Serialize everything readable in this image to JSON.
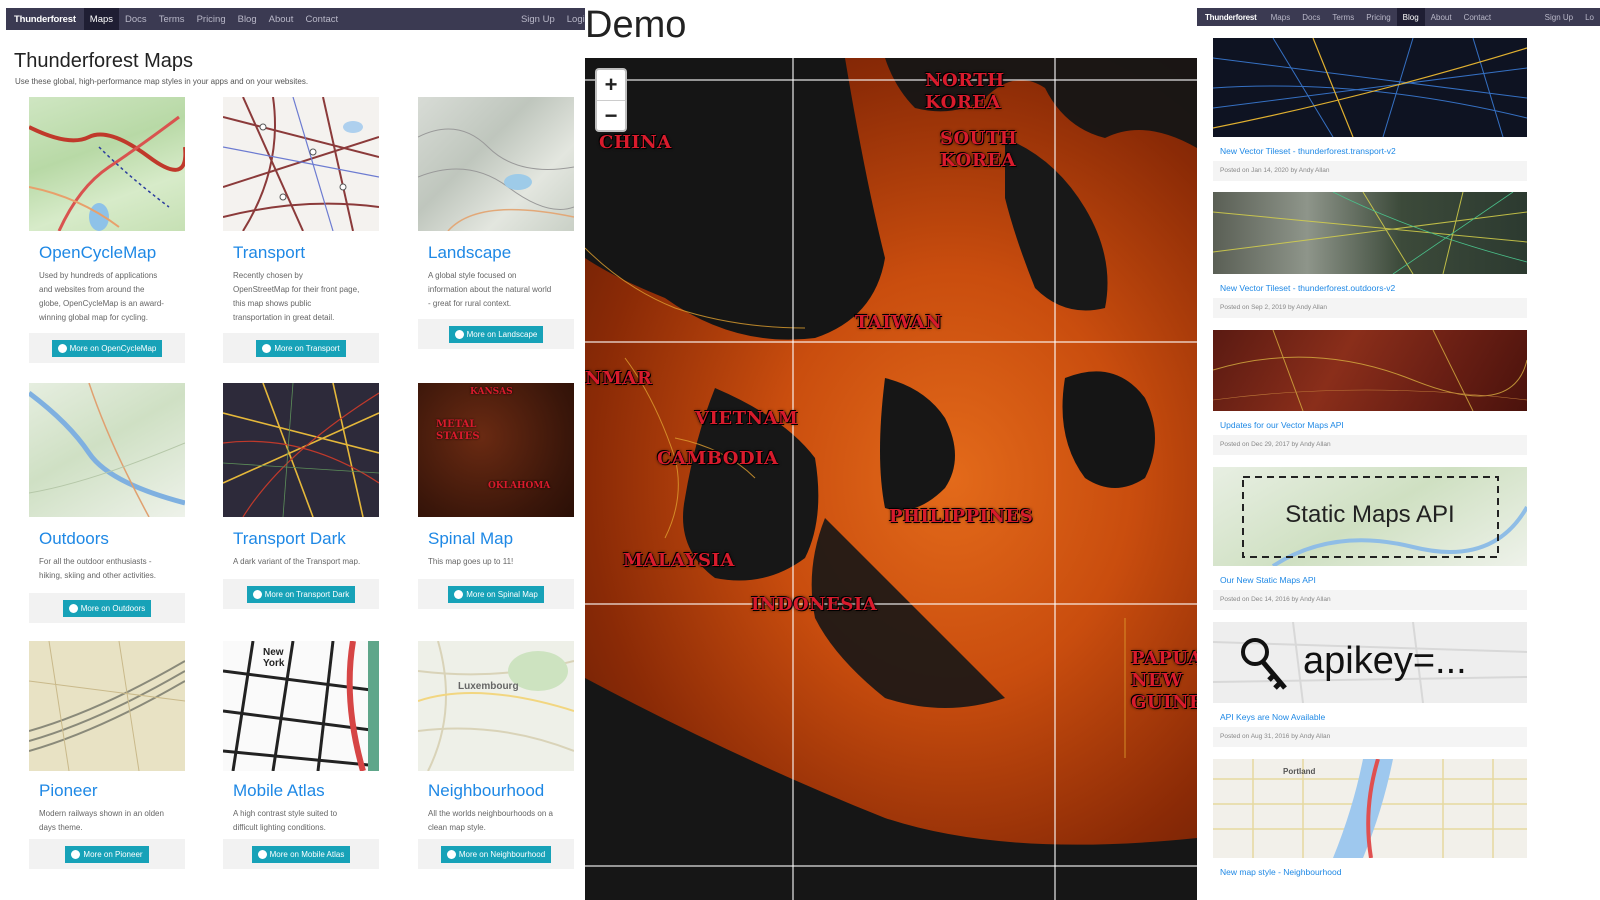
{
  "left": {
    "nav": {
      "brand": "Thunderforest",
      "items": [
        "Maps",
        "Docs",
        "Terms",
        "Pricing",
        "Blog",
        "About",
        "Contact"
      ],
      "active": "Maps",
      "right_items": [
        "Sign Up",
        "Login"
      ]
    },
    "title": "Thunderforest Maps",
    "subtitle": "Use these global, high-performance map styles in your apps and on your websites.",
    "cards": [
      {
        "name": "OpenCycleMap",
        "desc": "Used by hundreds of applications and websites from around the globe, OpenCycleMap is an award-winning global map for cycling.",
        "button": "More on OpenCycleMap"
      },
      {
        "name": "Transport",
        "desc": "Recently chosen by OpenStreetMap for their front page, this map shows public transportation in great detail.",
        "button": "More on Transport"
      },
      {
        "name": "Landscape",
        "desc": "A global style focused on information about the natural world - great for rural context.",
        "button": "More on Landscape"
      },
      {
        "name": "Outdoors",
        "desc": "For all the outdoor enthusiasts - hiking, skiing and other activities.",
        "button": "More on Outdoors"
      },
      {
        "name": "Transport Dark",
        "desc": "A dark variant of the Transport map.",
        "button": "More on Transport Dark"
      },
      {
        "name": "Spinal Map",
        "desc": "This map goes up to 11!",
        "button": "More on Spinal Map"
      },
      {
        "name": "Pioneer",
        "desc": "Modern railways shown in an olden days theme.",
        "button": "More on Pioneer"
      },
      {
        "name": "Mobile Atlas",
        "desc": "A high contrast style suited to difficult lighting conditions.",
        "button": "More on Mobile Atlas"
      },
      {
        "name": "Neighbourhood",
        "desc": "All the worlds neighbourhoods on a clean map style.",
        "button": "More on Neighbourhood"
      }
    ],
    "thumb_labels": {
      "spinal": [
        "KANSAS",
        "METAL STATES",
        "OKLAHOMA"
      ],
      "mobile": "New York",
      "neighbourhood": "Luxembourg"
    }
  },
  "center": {
    "title": "Demo",
    "zoom_in": "+",
    "zoom_out": "−",
    "labels": [
      "NORTH KOREA",
      "SOUTH KOREA",
      "CHINA",
      "TAIWAN",
      "NMAR",
      "VIETNAM",
      "CAMBODIA",
      "PHILIPPINES",
      "MALAYSIA",
      "INDONESIA",
      "PAPUA NEW GUINEA"
    ]
  },
  "right": {
    "nav": {
      "brand": "Thunderforest",
      "items": [
        "Maps",
        "Docs",
        "Terms",
        "Pricing",
        "Blog",
        "About",
        "Contact"
      ],
      "active": "Blog",
      "right_items": [
        "Sign Up",
        "Lo"
      ]
    },
    "posts": [
      {
        "title": "New Vector Tileset - thunderforest.transport-v2",
        "meta": "Posted on Jan 14, 2020 by Andy Allan"
      },
      {
        "title": "New Vector Tileset - thunderforest.outdoors-v2",
        "meta": "Posted on Sep 2, 2019 by Andy Allan"
      },
      {
        "title": "Updates for our Vector Maps API",
        "meta": "Posted on Dec 29, 2017 by Andy Allan"
      },
      {
        "title": "Our New Static Maps API",
        "meta": "Posted on Dec 14, 2016 by Andy Allan",
        "thumb_text": "Static Maps API"
      },
      {
        "title": "API Keys are Now Available",
        "meta": "Posted on Aug 31, 2016 by Andy Allan",
        "thumb_text": "apikey=..."
      },
      {
        "title": "New map style - Neighbourhood",
        "meta": "",
        "thumb_text": "Portland"
      }
    ]
  }
}
